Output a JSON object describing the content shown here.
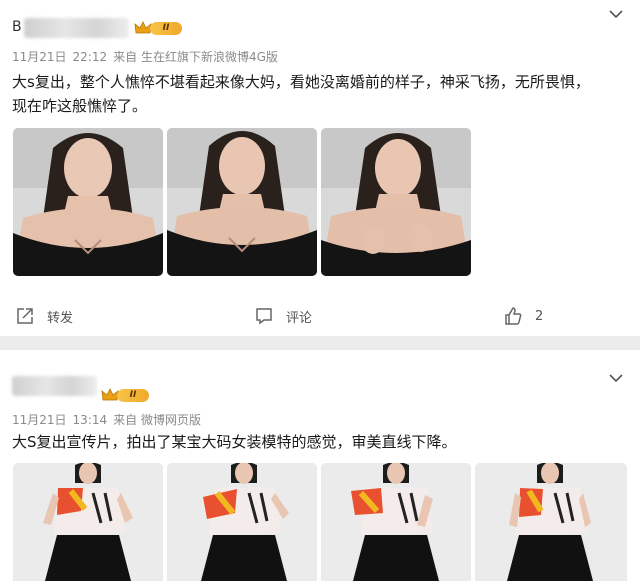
{
  "posts": [
    {
      "username_visible": "B",
      "vip_level": "II",
      "date": "11月21日",
      "time": "22:12",
      "source": "来自 生在红旗下新浪微博4G版",
      "text_line1": "大s复出，整个人憔悴不堪看起来像大妈，看她没离婚前的样子，神采飞扬，无所畏惧，",
      "text_line2": "现在咋这般憔悴了。",
      "actions": {
        "repost": "转发",
        "comment": "评论",
        "likes": "2"
      }
    },
    {
      "vip_level": "II",
      "date": "11月21日",
      "time": "13:14",
      "source": "来自 微博网页版",
      "text_line1": "大S复出宣传片，拍出了某宝大码女装模特的感觉，审美直线下降。"
    }
  ],
  "icons": {
    "more": "chevron-down-icon",
    "vip": "crown-icon",
    "repost": "share-out-icon",
    "comment": "comment-icon",
    "like": "thumbs-up-icon"
  },
  "colors": {
    "vip_gold": "#f0a92a",
    "meta_gray": "#8a8a8a",
    "background": "#ececec"
  }
}
